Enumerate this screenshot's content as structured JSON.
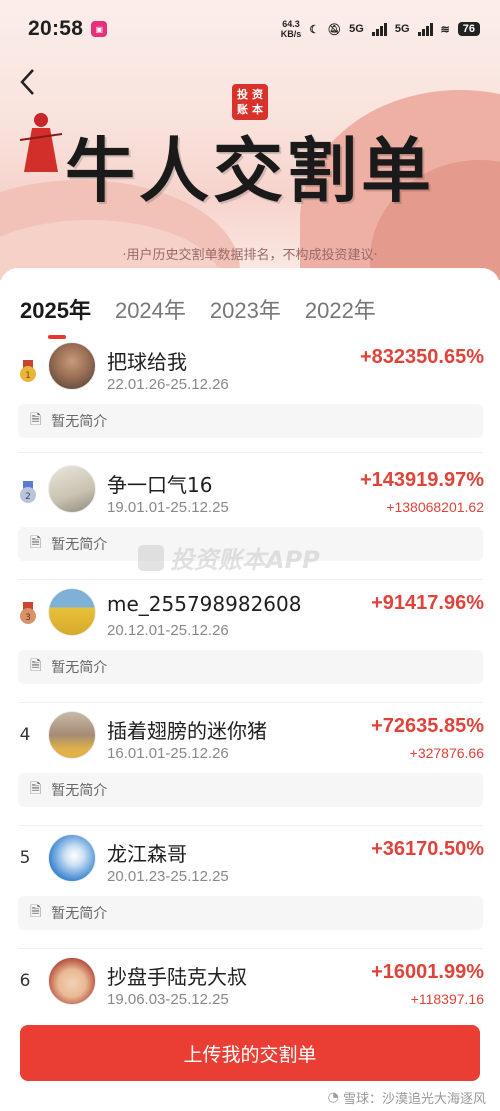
{
  "status_bar": {
    "time": "20:58",
    "net_speed_value": "64.3",
    "net_speed_unit": "KB/s",
    "signal_1": "5G",
    "signal_2": "5G",
    "battery": "76"
  },
  "banner": {
    "seal_chars": [
      "投",
      "资",
      "账",
      "本"
    ],
    "title": "牛人交割单",
    "subtitle": "·用户历史交割单数据排名，不构成投资建议·"
  },
  "tabs": [
    {
      "label": "2025年",
      "active": true
    },
    {
      "label": "2024年",
      "active": false
    },
    {
      "label": "2023年",
      "active": false
    },
    {
      "label": "2022年",
      "active": false
    }
  ],
  "intro_placeholder": "暂无简介",
  "watermark": "投资账本APP",
  "ranking": [
    {
      "rank": "1",
      "medal": "gold",
      "name": "把球给我",
      "dates": "22.01.26-25.12.26",
      "pct": "+832350.65%",
      "amount": ""
    },
    {
      "rank": "2",
      "medal": "silver",
      "name": "争一口气16",
      "dates": "19.01.01-25.12.25",
      "pct": "+143919.97%",
      "amount": "+138068201.62"
    },
    {
      "rank": "3",
      "medal": "bronze",
      "name": "me_255798982608",
      "dates": "20.12.01-25.12.26",
      "pct": "+91417.96%",
      "amount": ""
    },
    {
      "rank": "4",
      "medal": "",
      "name": "插着翅膀的迷你猪",
      "dates": "16.01.01-25.12.26",
      "pct": "+72635.85%",
      "amount": "+327876.66"
    },
    {
      "rank": "5",
      "medal": "",
      "name": "龙江森哥",
      "dates": "20.01.23-25.12.25",
      "pct": "+36170.50%",
      "amount": ""
    },
    {
      "rank": "6",
      "medal": "",
      "name": "抄盘手陆克大叔",
      "dates": "19.06.03-25.12.25",
      "pct": "+16001.99%",
      "amount": "+118397.16"
    }
  ],
  "upload_button": "上传我的交割单",
  "credit": "雪球：沙漠追光大海逐风",
  "colors": {
    "accent_red": "#e0433a",
    "button_red": "#ea3e34"
  }
}
